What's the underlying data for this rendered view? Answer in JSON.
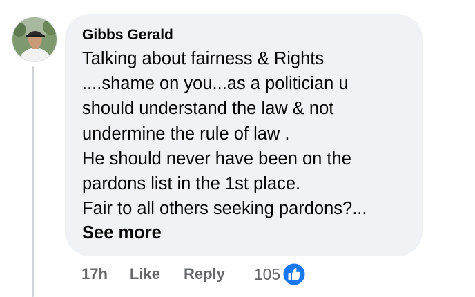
{
  "comment": {
    "author": "Gibbs Gerald",
    "lines": [
      "Talking about fairness & Rights",
      "....shame on you...as a politician u",
      "should understand the law & not",
      "undermine the rule of law .",
      "He should never have been on the",
      "pardons list in the 1st place.",
      "Fair to all others seeking pardons?..."
    ],
    "see_more_label": "See more"
  },
  "actions": {
    "timestamp": "17h",
    "like_label": "Like",
    "reply_label": "Reply",
    "reaction_count": "105",
    "reaction_icon": "thumbs-up-icon"
  },
  "colors": {
    "bubble_bg": "#f0f2f5",
    "secondary_text": "#65676b",
    "like_blue": "#1877f2",
    "thread_line": "#d0d2d6"
  }
}
